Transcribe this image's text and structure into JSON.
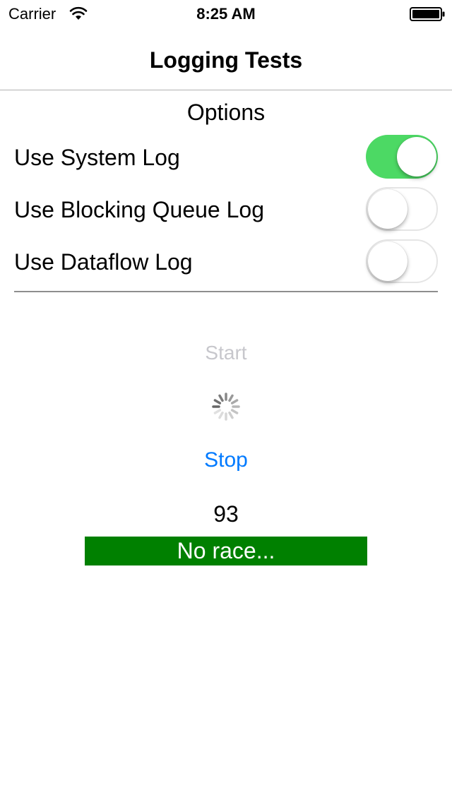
{
  "status_bar": {
    "carrier": "Carrier",
    "time": "8:25 AM"
  },
  "nav": {
    "title": "Logging Tests"
  },
  "options": {
    "title": "Options",
    "items": [
      {
        "label": "Use System Log",
        "enabled": true
      },
      {
        "label": "Use Blocking Queue Log",
        "enabled": false
      },
      {
        "label": "Use Dataflow Log",
        "enabled": false
      }
    ]
  },
  "controls": {
    "start_label": "Start",
    "stop_label": "Stop",
    "counter": "93",
    "race_status": "No race..."
  },
  "colors": {
    "switch_on": "#4cd964",
    "link_blue": "#007aff",
    "disabled_gray": "#c7c7cc",
    "banner_green": "#008000"
  }
}
